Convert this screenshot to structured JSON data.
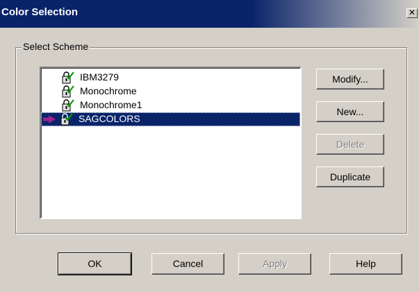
{
  "window": {
    "title": "Color Selection",
    "close_symbol": "✕",
    "title_bar_color": "#0a246a",
    "face_color": "#d4d0c8"
  },
  "group": {
    "label": "Select Scheme"
  },
  "schemes": {
    "items": [
      {
        "label": "IBM3279",
        "icon": "scheme-lock-check-icon",
        "selected": false
      },
      {
        "label": "Monochrome",
        "icon": "scheme-lock-check-icon",
        "selected": false
      },
      {
        "label": "Monochrome1",
        "icon": "scheme-lock-check-icon",
        "selected": false
      },
      {
        "label": "SAGCOLORS",
        "icon": "scheme-lock-check-icon",
        "selected": true,
        "current_marker": "current-scheme-arrow-icon"
      }
    ],
    "selection_color": "#0a246a",
    "arrow_color": "#a0208c"
  },
  "side_buttons": {
    "modify": {
      "label": "Modify...",
      "enabled": true
    },
    "new": {
      "label": "New...",
      "enabled": true
    },
    "delete": {
      "label": "Delete",
      "enabled": false
    },
    "duplicate": {
      "label": "Duplicate",
      "enabled": true
    }
  },
  "bottom_buttons": {
    "ok": {
      "label": "OK",
      "enabled": true
    },
    "cancel": {
      "label": "Cancel",
      "enabled": true
    },
    "apply": {
      "label": "Apply",
      "enabled": false
    },
    "help": {
      "label": "Help",
      "enabled": true
    }
  }
}
